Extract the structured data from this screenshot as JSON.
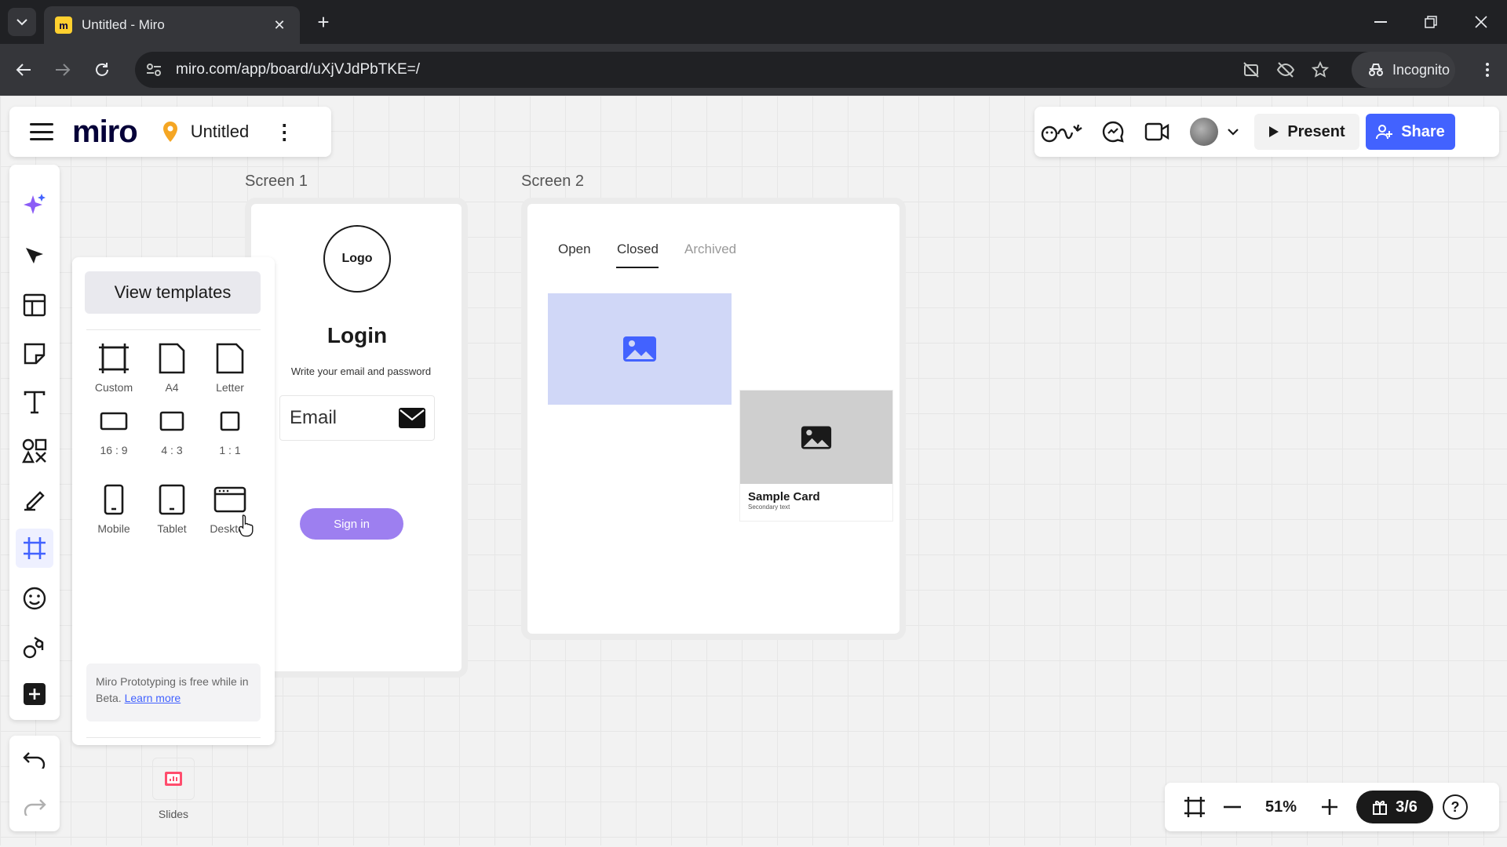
{
  "browser": {
    "tab_title": "Untitled - Miro",
    "url": "miro.com/app/board/uXjVJdPbTKE=/",
    "incognito_label": "Incognito"
  },
  "board": {
    "logo_text": "miro",
    "title": "Untitled",
    "present_label": "Present",
    "share_label": "Share",
    "accent_color": "#4262ff"
  },
  "left_tools": [
    {
      "name": "ai-sparkle-icon"
    },
    {
      "name": "select-cursor-icon"
    },
    {
      "name": "templates-icon"
    },
    {
      "name": "sticky-note-icon"
    },
    {
      "name": "text-icon"
    },
    {
      "name": "shapes-icon"
    },
    {
      "name": "pen-icon"
    },
    {
      "name": "frame-icon"
    },
    {
      "name": "emoji-stickers-icon"
    },
    {
      "name": "apps-icon"
    },
    {
      "name": "add-more-icon"
    }
  ],
  "templates_panel": {
    "view_templates_label": "View templates",
    "frames": [
      {
        "label": "Custom",
        "icon": "frame-custom-icon"
      },
      {
        "label": "A4",
        "icon": "frame-a4-icon"
      },
      {
        "label": "Letter",
        "icon": "frame-letter-icon"
      },
      {
        "label": "16 : 9",
        "icon": "frame-16-9-icon"
      },
      {
        "label": "4 : 3",
        "icon": "frame-4-3-icon"
      },
      {
        "label": "1 : 1",
        "icon": "frame-1-1-icon"
      },
      {
        "label": "Mobile",
        "icon": "frame-mobile-icon"
      },
      {
        "label": "Tablet",
        "icon": "frame-tablet-icon"
      },
      {
        "label": "Desktop",
        "icon": "frame-desktop-icon"
      }
    ],
    "beta_note": "Miro Prototyping is free while in Beta.",
    "learn_more": "Learn more",
    "slides_label": "Slides"
  },
  "screen1": {
    "label": "Screen 1",
    "logo_text": "Logo",
    "title": "Login",
    "subtitle": "Write your email and password",
    "email_placeholder": "Email",
    "signin_label": "Sign in",
    "signin_color": "#9d7ff0"
  },
  "screen2": {
    "label": "Screen 2",
    "tabs": [
      "Open",
      "Closed",
      "Archived"
    ],
    "active_tab": "Closed",
    "card_title": "Sample Card",
    "card_subtitle": "Secondary text"
  },
  "bottom_bar": {
    "zoom": "51%",
    "frames_count": "3/6",
    "help_label": "?"
  }
}
